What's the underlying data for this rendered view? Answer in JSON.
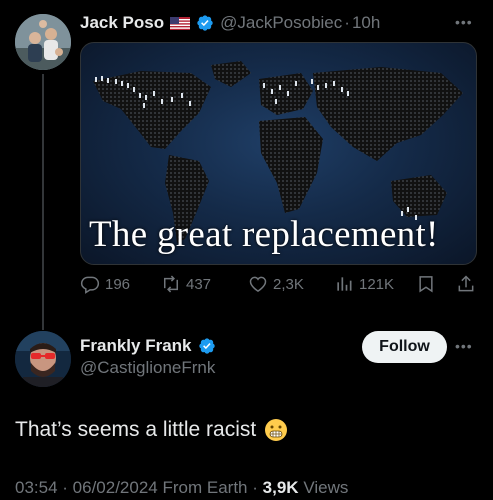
{
  "parent_tweet": {
    "display_name": "Jack Poso",
    "flag": "🇺🇸",
    "handle": "@JackPosobiec",
    "separator": "·",
    "time_ago": "10h",
    "more_icon": "more-horizontal-icon",
    "media": {
      "caption": "The great replacement!"
    },
    "actions": {
      "replies": "196",
      "reposts": "437",
      "likes": "2,3K",
      "views": "121K"
    }
  },
  "reply_tweet": {
    "display_name": "Frankly Frank",
    "handle": "@CastiglioneFrnk",
    "follow_label": "Follow",
    "text": "That’s seems a little racist",
    "emoji": "grimacing-face",
    "meta": {
      "time": "03:54",
      "date": "06/02/2024",
      "source": "From Earth",
      "views_count": "3,9K",
      "views_label": "Views"
    }
  },
  "colors": {
    "background": "#000000",
    "text_primary": "#e7e9ea",
    "text_muted": "#71767b",
    "verified_blue": "#1d9bf0",
    "follow_bg": "#eff3f4"
  }
}
